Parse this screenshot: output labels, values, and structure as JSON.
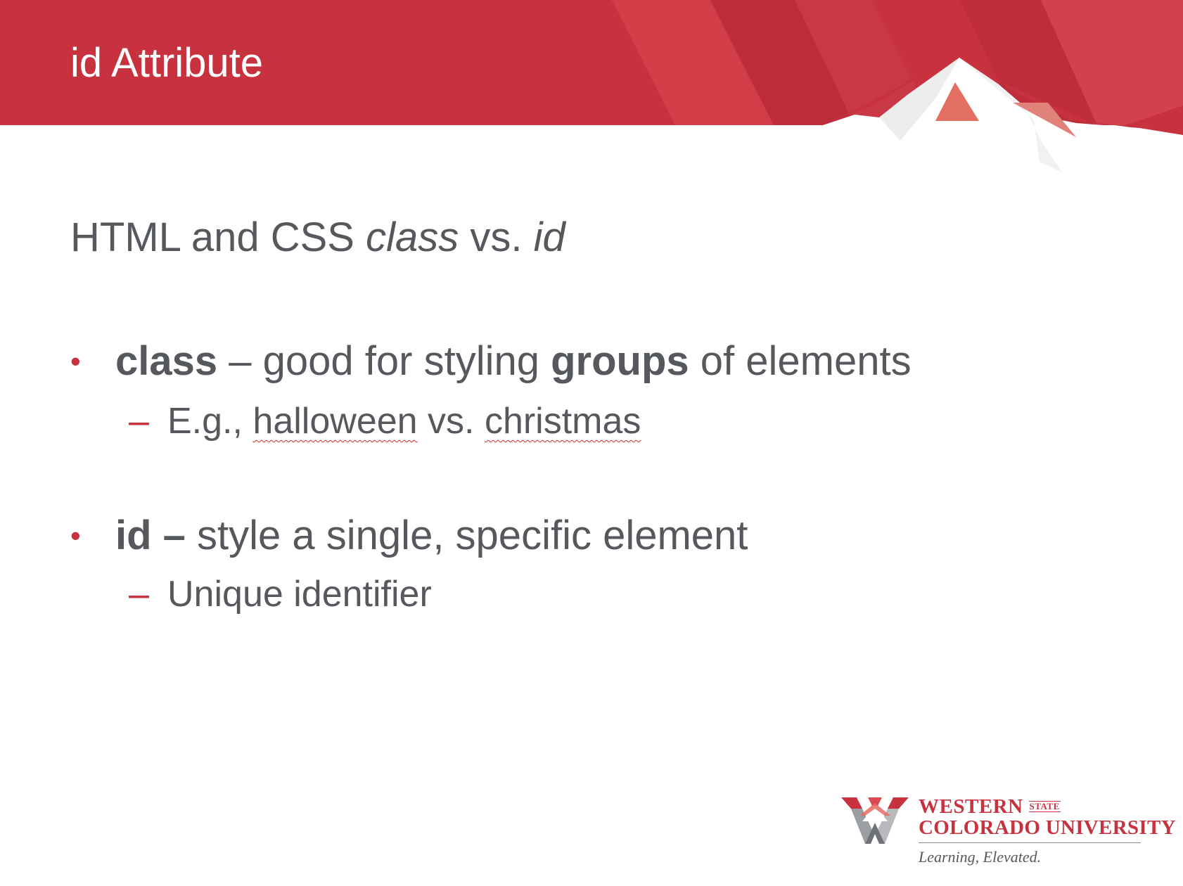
{
  "slide": {
    "title": "id Attribute",
    "subtitle": {
      "part1": "HTML and CSS ",
      "class_word": "class",
      "part2": " vs. ",
      "id_word": "id"
    },
    "bullets": [
      {
        "marker": "•",
        "term": "class",
        "text_a": " – good for styling ",
        "emphasis": "groups",
        "text_b": " of elements",
        "sub": {
          "marker": "–",
          "prefix": "E.g., ",
          "word_a": "halloween",
          "middle": " vs. ",
          "word_b": "christmas"
        }
      },
      {
        "marker": "•",
        "term": "id –",
        "text_a": " style a single, specific element",
        "sub": {
          "marker": "–",
          "text": "Unique identifier"
        }
      }
    ]
  },
  "logo": {
    "line1": "Western",
    "state": "STATE",
    "line2": "Colorado University",
    "tagline": "Learning, Elevated."
  },
  "colors": {
    "brand_red": "#c8323e",
    "text_gray": "#55585c",
    "background": "#ffffff"
  }
}
